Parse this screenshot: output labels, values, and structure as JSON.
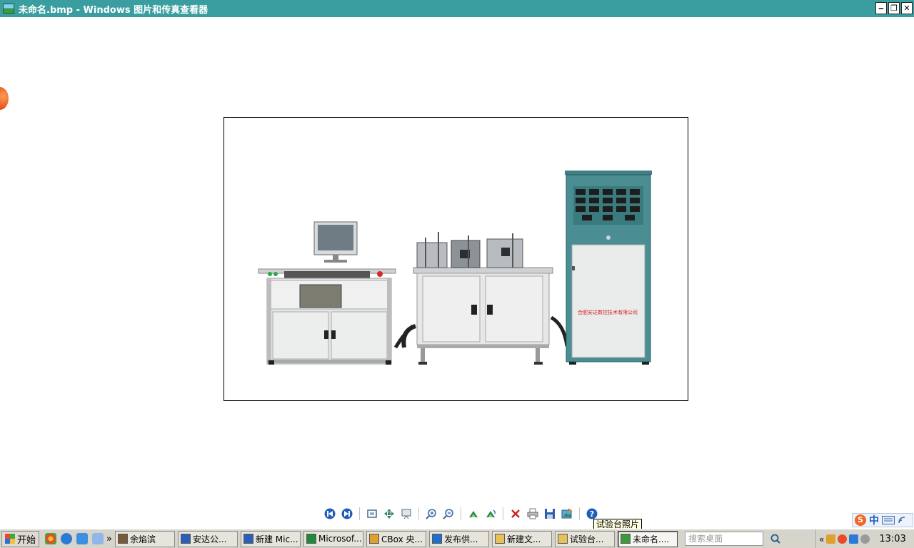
{
  "window": {
    "title": "未命名.bmp - Windows 图片和传真查看器",
    "minimize_glyph": "‒",
    "restore_glyph": "❐",
    "close_glyph": "✕"
  },
  "viewer": {
    "image_caption": "合肥安达数控技术有限公司",
    "toolbar": [
      {
        "name": "previous-image-button",
        "icon": "prev-icon"
      },
      {
        "name": "next-image-button",
        "icon": "next-icon"
      },
      {
        "name": "best-fit-button",
        "icon": "best-fit-icon"
      },
      {
        "name": "actual-size-button",
        "icon": "actual-size-icon"
      },
      {
        "name": "slideshow-button",
        "icon": "slideshow-icon"
      },
      {
        "name": "zoom-in-button",
        "icon": "zoom-in-icon"
      },
      {
        "name": "zoom-out-button",
        "icon": "zoom-out-icon"
      },
      {
        "name": "rotate-clockwise-button",
        "icon": "rotate-cw-icon"
      },
      {
        "name": "rotate-counterclockwise-button",
        "icon": "rotate-ccw-icon"
      },
      {
        "name": "delete-button",
        "icon": "delete-icon"
      },
      {
        "name": "print-button",
        "icon": "print-icon"
      },
      {
        "name": "save-button",
        "icon": "save-icon"
      },
      {
        "name": "edit-button",
        "icon": "edit-icon"
      },
      {
        "name": "help-button",
        "icon": "help-icon"
      }
    ],
    "tooltip": "试验台照片"
  },
  "ime": {
    "logo": "S",
    "mode": "中"
  },
  "taskbar": {
    "start_label": "开始",
    "overflow": "»",
    "tasks": [
      {
        "label": "余焰滨",
        "color": "#7a5a3a",
        "active": false
      },
      {
        "label": "安达公...",
        "color": "#2a5fb8",
        "active": false
      },
      {
        "label": "新建 Mic...",
        "color": "#2a5fb8",
        "active": false
      },
      {
        "label": "Microsof...",
        "color": "#1f8a3a",
        "active": false
      },
      {
        "label": "CBox 央...",
        "color": "#e0a030",
        "active": false
      },
      {
        "label": "发布供...",
        "color": "#1f6fcf",
        "active": false
      },
      {
        "label": "新建文...",
        "color": "#e6c15a",
        "active": false
      },
      {
        "label": "试验台...",
        "color": "#e6c15a",
        "active": false
      },
      {
        "label": "未命名....",
        "color": "#3c9a3c",
        "active": true
      }
    ],
    "search_placeholder": "搜索桌面",
    "tray_chevron": "«",
    "clock": "13:03"
  }
}
